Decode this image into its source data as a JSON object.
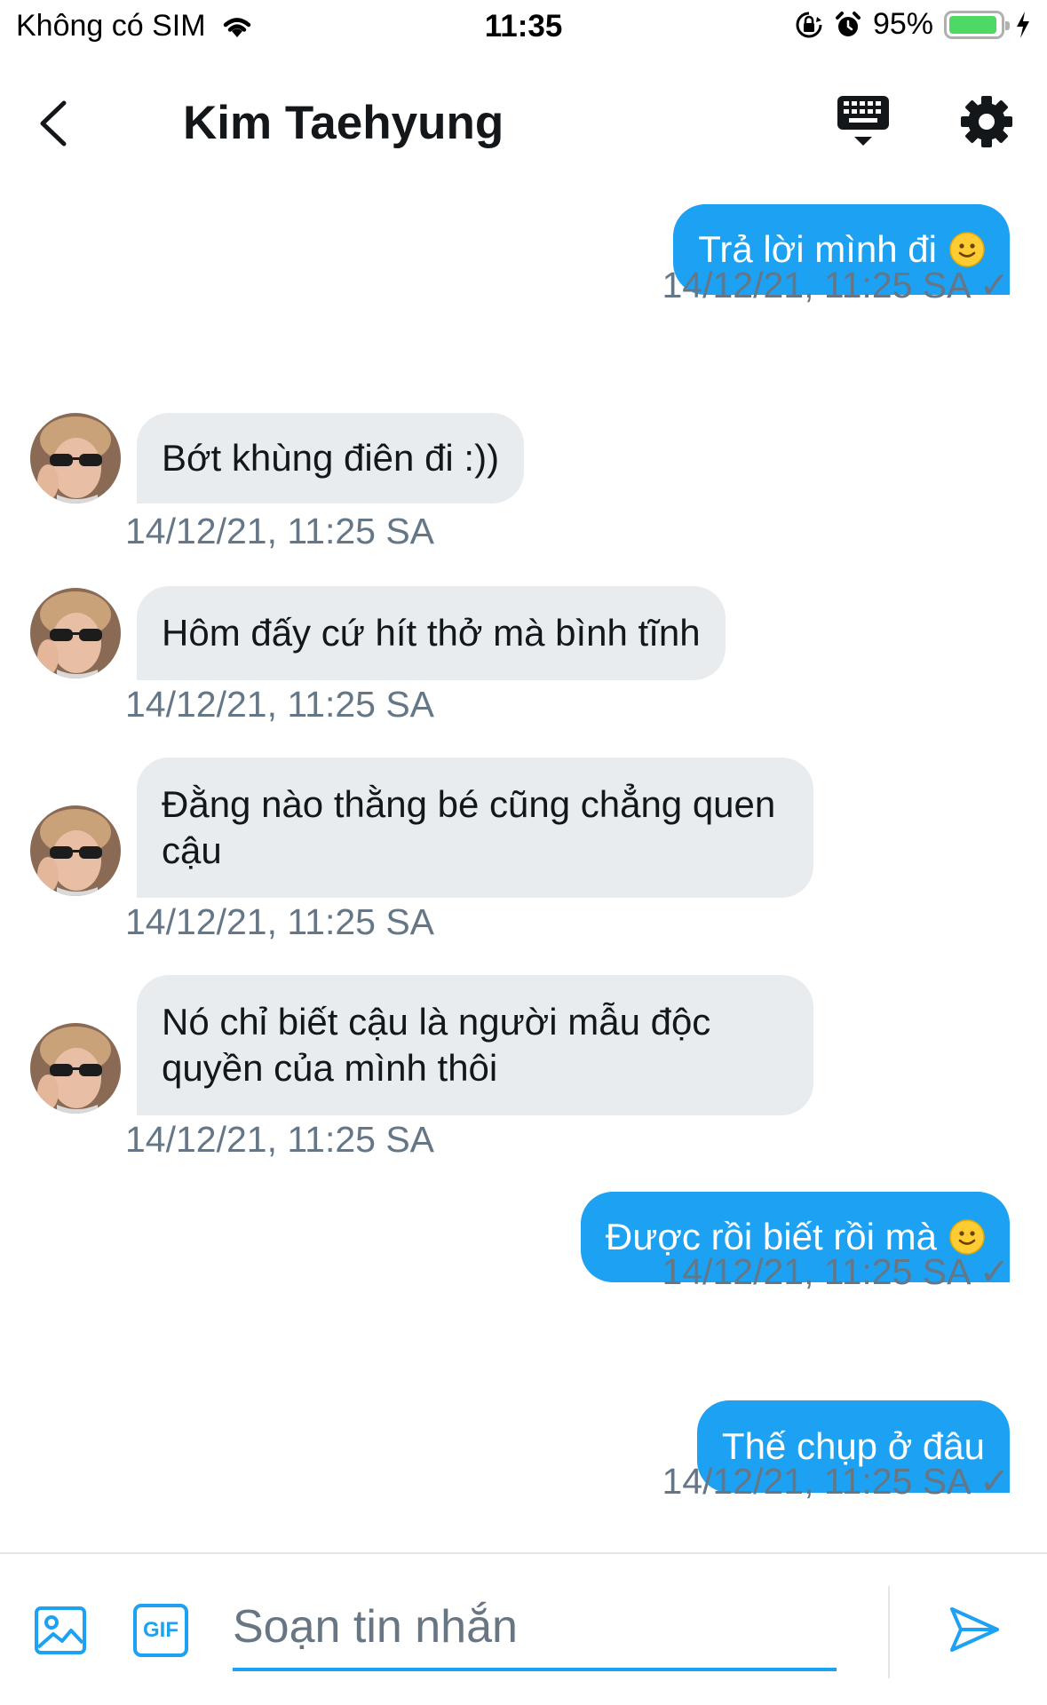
{
  "status_bar": {
    "carrier": "Không có SIM",
    "time": "11:35",
    "battery_percent": "95%",
    "battery_level": 0.95
  },
  "header": {
    "title": "Kim Taehyung",
    "back_icon": "chevron-left-icon",
    "keyboard_icon": "keyboard-icon",
    "settings_icon": "gear-icon"
  },
  "colors": {
    "accent": "#1da1f2",
    "incoming_bubble": "#e9ecef",
    "timestamp": "#657786"
  },
  "messages": [
    {
      "direction": "out",
      "text": "Trả lời mình đi",
      "emoji": "slightly-smiling-face",
      "timestamp": "14/12/21, 11:25 SA ✓"
    },
    {
      "direction": "in",
      "text": "Bớt khùng điên đi :))",
      "timestamp": "14/12/21, 11:25 SA"
    },
    {
      "direction": "in",
      "text": "Hôm đấy cứ hít thở mà bình tĩnh",
      "timestamp": "14/12/21, 11:25 SA"
    },
    {
      "direction": "in",
      "text": "Đằng nào thằng bé cũng chẳng quen cậu",
      "timestamp": "14/12/21, 11:25 SA"
    },
    {
      "direction": "in",
      "text": "Nó chỉ biết cậu là người mẫu độc quyền của mình thôi",
      "timestamp": "14/12/21, 11:25 SA"
    },
    {
      "direction": "out",
      "text": "Được rồi biết rồi mà",
      "emoji": "slightly-smiling-face",
      "timestamp": "14/12/21, 11:25 SA ✓"
    },
    {
      "direction": "out",
      "text": "Thế chụp ở đâu",
      "timestamp": "14/12/21, 11:25 SA ✓"
    }
  ],
  "composer": {
    "placeholder": "Soạn tin nhắn",
    "value": "",
    "gif_label": "GIF",
    "image_icon": "image-icon",
    "send_icon": "send-icon"
  }
}
